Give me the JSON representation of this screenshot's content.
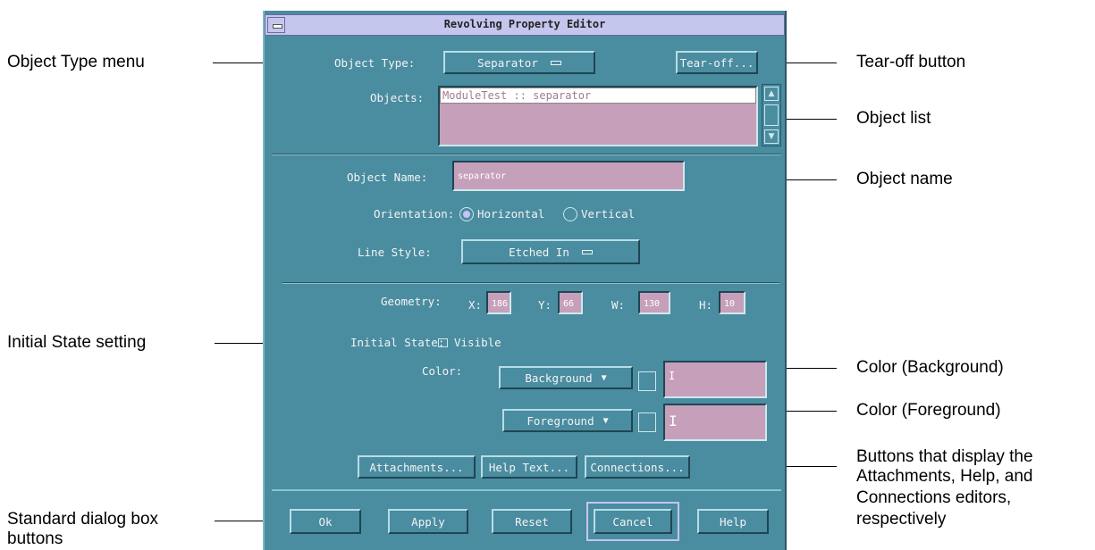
{
  "window": {
    "title": "Revolving Property Editor"
  },
  "editor": {
    "object_type_label": "Object Type:",
    "object_type_value": "Separator",
    "tear_off_label": "Tear-off...",
    "objects_label": "Objects:",
    "objects_list": [
      "ModuleTest :: separator"
    ],
    "object_name_label": "Object Name:",
    "object_name_value": "separator",
    "orientation_label": "Orientation:",
    "orientation_horizontal": "Horizontal",
    "orientation_vertical": "Vertical",
    "line_style_label": "Line Style:",
    "line_style_value": "Etched In",
    "geometry_label": "Geometry:",
    "geometry": {
      "x_label": "X:",
      "x_value": "186",
      "y_label": "Y:",
      "y_value": "66",
      "w_label": "W:",
      "w_value": "130",
      "h_label": "H:",
      "h_value": "10"
    },
    "initial_state_label": "Initial State:",
    "visible_label": "Visible",
    "color_label": "Color:",
    "background_button": "Background",
    "foreground_button": "Foreground",
    "background_text": "I",
    "foreground_text": "I",
    "attachments_button": "Attachments...",
    "help_text_button": "Help Text...",
    "connections_button": "Connections..."
  },
  "dialog_buttons": {
    "ok": "Ok",
    "apply": "Apply",
    "reset": "Reset",
    "cancel": "Cancel",
    "help": "Help"
  },
  "callouts": {
    "object_type_menu": "Object Type menu",
    "initial_state_setting": "Initial State setting",
    "standard_buttons_1": "Standard dialog box",
    "standard_buttons_2": "buttons",
    "tear_off_button": "Tear-off button",
    "object_list": "Object list",
    "object_name": "Object name",
    "color_background": "Color (Background)",
    "color_foreground": "Color (Foreground)",
    "editors_buttons_1": "Buttons that display the",
    "editors_buttons_2": "Attachments, Help, and",
    "editors_buttons_3": "Connections editors,",
    "editors_buttons_4": "respectively"
  },
  "colors": {
    "panel": "#4a8ca0",
    "field": "#c6a0ba",
    "titlebar": "#c4c6ee"
  }
}
